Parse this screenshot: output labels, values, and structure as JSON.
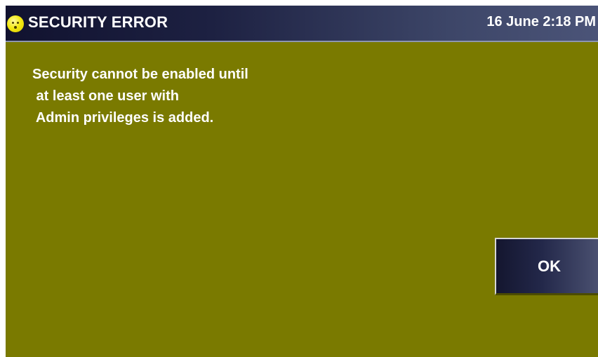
{
  "titlebar": {
    "status_icon": "smiley-face-icon",
    "title": "SECURITY ERROR",
    "datetime": "16 June 2:18 PM"
  },
  "dialog": {
    "message_lines": [
      "Security cannot be enabled until",
      " at least one user with",
      " Admin privileges is added."
    ],
    "ok_label": "OK"
  },
  "colors": {
    "background": "#7a7a00",
    "titlebar": "#1d2142",
    "text": "#ffffff",
    "icon": "#f4ea13"
  }
}
